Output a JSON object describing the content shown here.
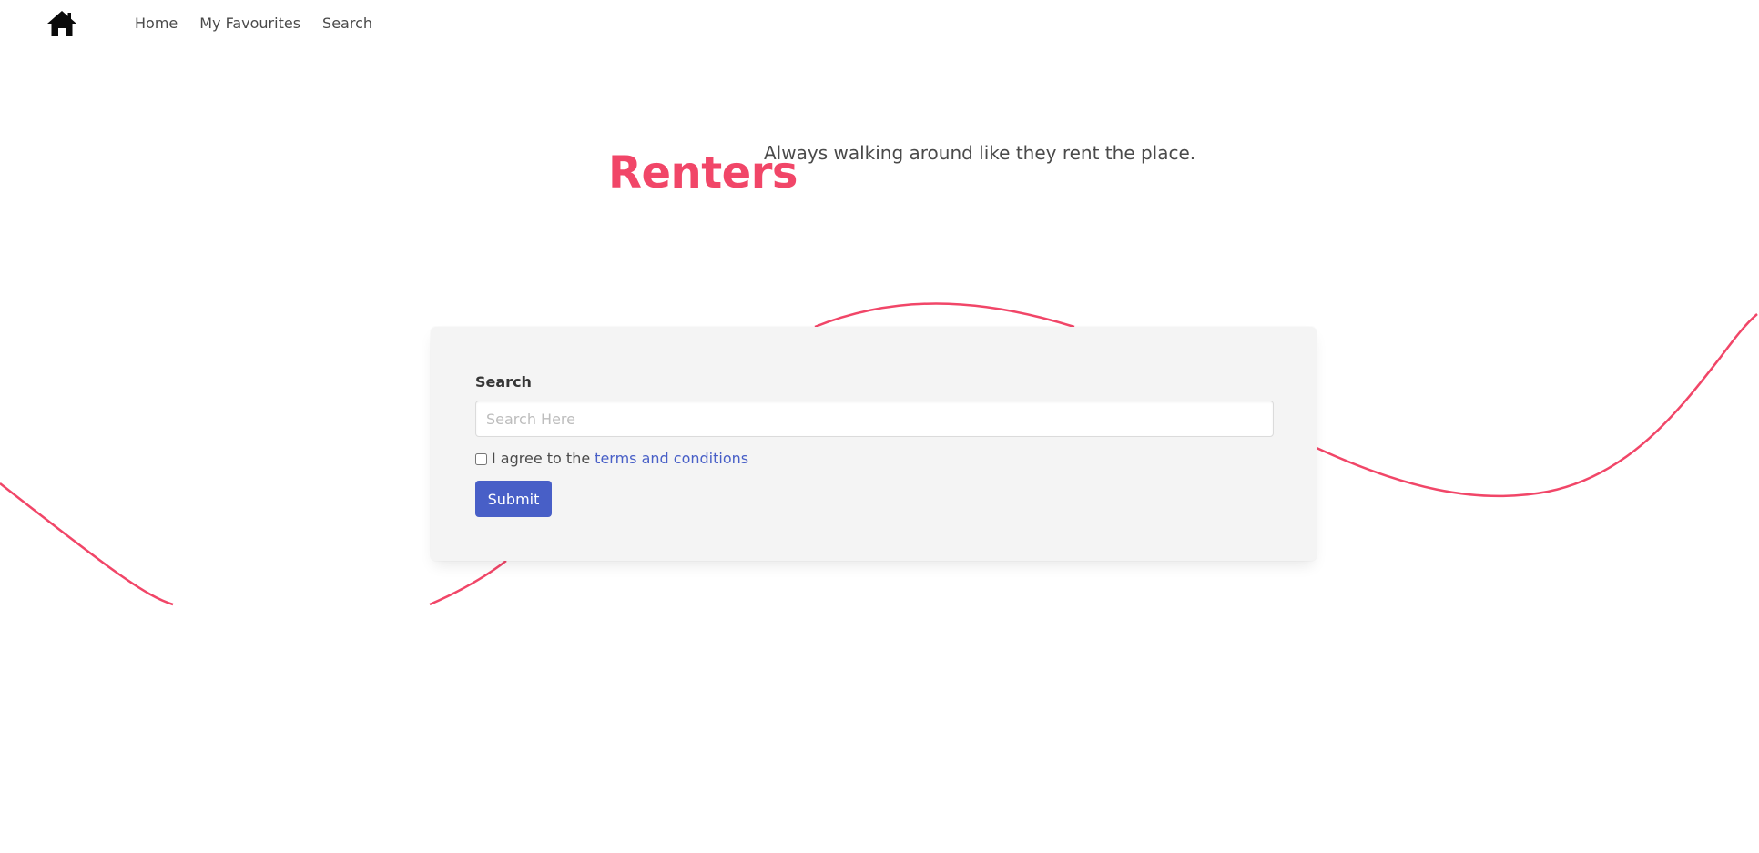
{
  "colors": {
    "accent": "#f14668",
    "link": "#485fc7",
    "box_background": "#f4f4f4"
  },
  "nav": {
    "brand_icon": "home-icon",
    "links": [
      {
        "label": "Home"
      },
      {
        "label": "My Favourites"
      },
      {
        "label": "Search"
      }
    ]
  },
  "hero": {
    "title": "Renters",
    "subtitle": "Always walking around like they rent the place."
  },
  "form": {
    "search_label": "Search",
    "search_placeholder": "Search Here",
    "search_value": "",
    "agree_text": "I agree to the",
    "terms_link": "terms and conditions",
    "agree_checked": false,
    "submit_label": "Submit"
  }
}
